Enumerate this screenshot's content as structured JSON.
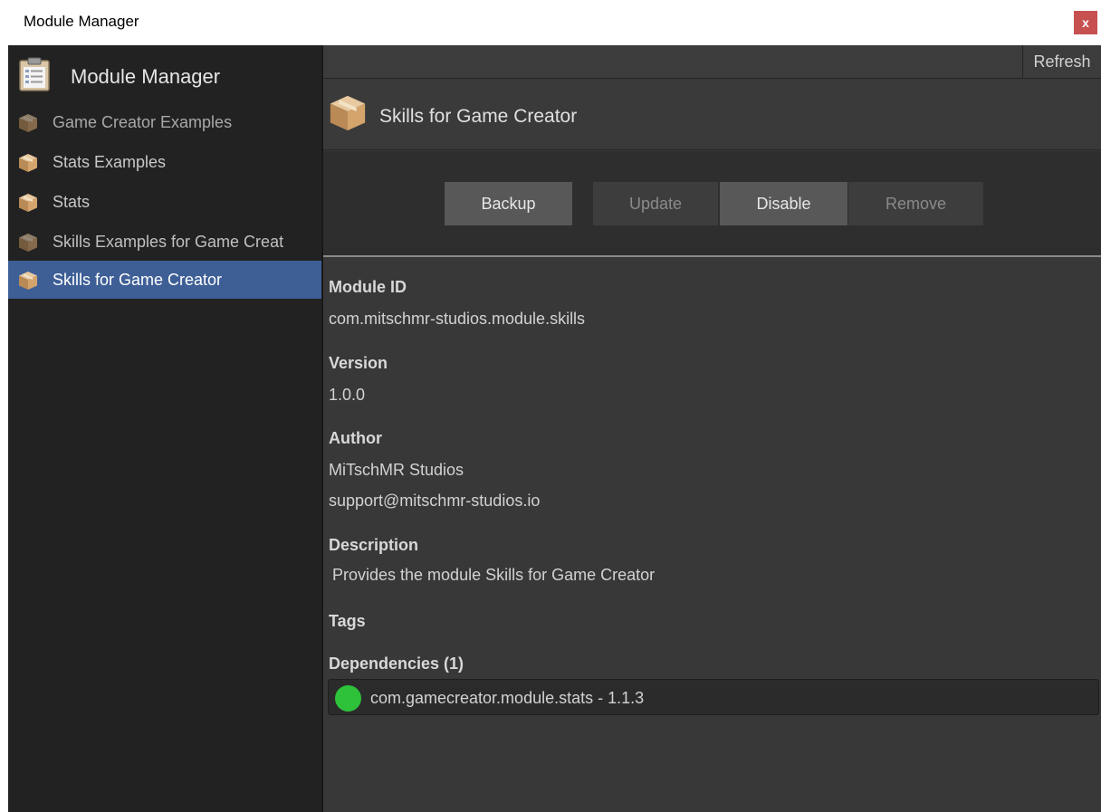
{
  "window": {
    "title": "Module Manager",
    "close_label": "x"
  },
  "sidebar": {
    "title": "Module Manager",
    "icon": "clipboard-icon",
    "items": [
      {
        "label": "Game Creator Examples",
        "icon": "package-box-icon",
        "state": "disabled"
      },
      {
        "label": "Stats Examples",
        "icon": "package-box-icon",
        "state": "enabled"
      },
      {
        "label": "Stats",
        "icon": "package-box-icon",
        "state": "enabled"
      },
      {
        "label": "Skills Examples for Game Creat",
        "icon": "package-box-icon",
        "state": "disabled"
      },
      {
        "label": "Skills for Game Creator",
        "icon": "package-box-icon",
        "state": "selected"
      }
    ]
  },
  "toolbar": {
    "refresh_label": "Refresh"
  },
  "module": {
    "name": "Skills for Game Creator",
    "icon": "package-box-icon",
    "actions": {
      "backup": "Backup",
      "update": "Update",
      "disable": "Disable",
      "remove": "Remove"
    },
    "fields": {
      "id_label": "Module ID",
      "id_value": "com.mitschmr-studios.module.skills",
      "version_label": "Version",
      "version_value": "1.0.0",
      "author_label": "Author",
      "author_name": "MiTschMR Studios",
      "author_email": "support@mitschmr-studios.io",
      "description_label": "Description",
      "description_value": "Provides the module Skills for Game Creator",
      "tags_label": "Tags",
      "dependencies_label": "Dependencies (1)"
    },
    "dependencies": [
      {
        "text": "com.gamecreator.module.stats - 1.1.3",
        "status_color": "#2ec23a"
      }
    ]
  },
  "colors": {
    "selection": "#3e5f96",
    "close_button": "#c75050",
    "dependency_ok": "#2ec23a"
  }
}
